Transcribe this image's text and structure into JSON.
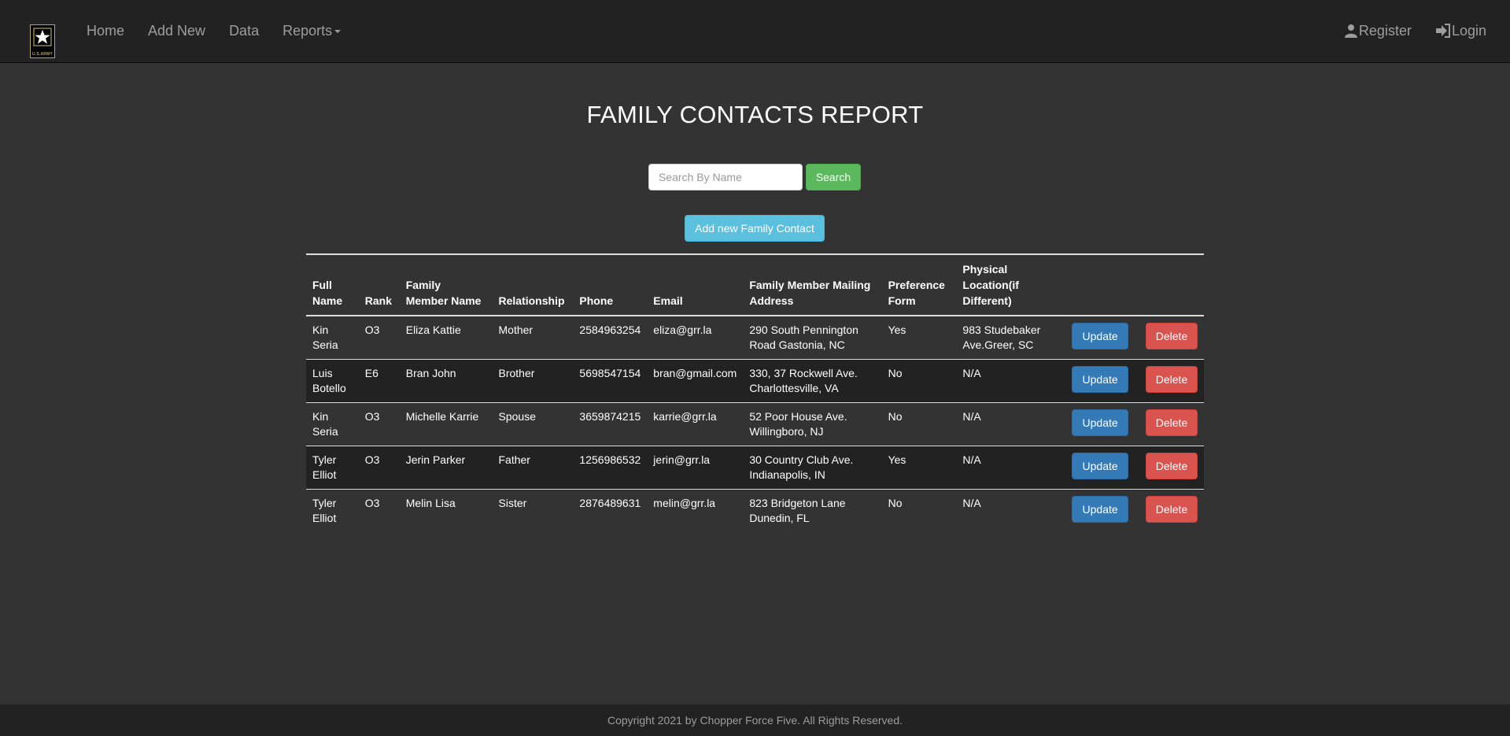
{
  "brand": {
    "logo_icon": "us-army-star-logo",
    "logo_text": "U.S.ARMY"
  },
  "nav": {
    "home": "Home",
    "add_new": "Add New",
    "data": "Data",
    "reports": "Reports",
    "register": "Register",
    "login": "Login"
  },
  "page": {
    "title": "FAMILY CONTACTS REPORT"
  },
  "search": {
    "placeholder": "Search By Name",
    "value": "",
    "button_label": "Search"
  },
  "add_button_label": "Add new Family Contact",
  "table": {
    "headers": [
      "Full Name",
      "Rank",
      "Family Member Name",
      "Relationship",
      "Phone",
      "Email",
      "Family Member Mailing Address",
      "Preference Form",
      "Physical Location(if Different)"
    ],
    "update_label": "Update",
    "delete_label": "Delete",
    "rows": [
      {
        "full_name": "Kin Seria",
        "rank": "O3",
        "family_member_name": "Eliza Kattie",
        "relationship": "Mother",
        "phone": "2584963254",
        "email": "eliza@grr.la",
        "address": "290 South Pennington Road Gastonia, NC",
        "preference_form": "Yes",
        "physical_location": "983 Studebaker Ave.Greer, SC"
      },
      {
        "full_name": "Luis Botello",
        "rank": "E6",
        "family_member_name": "Bran John",
        "relationship": "Brother",
        "phone": "5698547154",
        "email": "bran@gmail.com",
        "address": "330, 37 Rockwell Ave. Charlottesville, VA",
        "preference_form": "No",
        "physical_location": "N/A"
      },
      {
        "full_name": "Kin Seria",
        "rank": "O3",
        "family_member_name": "Michelle Karrie",
        "relationship": "Spouse",
        "phone": "3659874215",
        "email": "karrie@grr.la",
        "address": "52 Poor House Ave. Willingboro, NJ",
        "preference_form": "No",
        "physical_location": "N/A"
      },
      {
        "full_name": "Tyler Elliot",
        "rank": "O3",
        "family_member_name": "Jerin Parker",
        "relationship": "Father",
        "phone": "1256986532",
        "email": "jerin@grr.la",
        "address": "30 Country Club Ave. Indianapolis, IN",
        "preference_form": "Yes",
        "physical_location": "N/A"
      },
      {
        "full_name": "Tyler Elliot",
        "rank": "O3",
        "family_member_name": "Melin Lisa",
        "relationship": "Sister",
        "phone": "2876489631",
        "email": "melin@grr.la",
        "address": "823 Bridgeton Lane Dunedin, FL",
        "preference_form": "No",
        "physical_location": "N/A"
      }
    ]
  },
  "footer": {
    "copyright": "Copyright 2021 by Chopper Force Five. All Rights Reserved."
  },
  "colors": {
    "background": "#333333",
    "navbar": "#222222",
    "search_button": "#5cb85c",
    "add_button": "#5bc0de",
    "update_button": "#337ab7",
    "delete_button": "#d9534f"
  }
}
